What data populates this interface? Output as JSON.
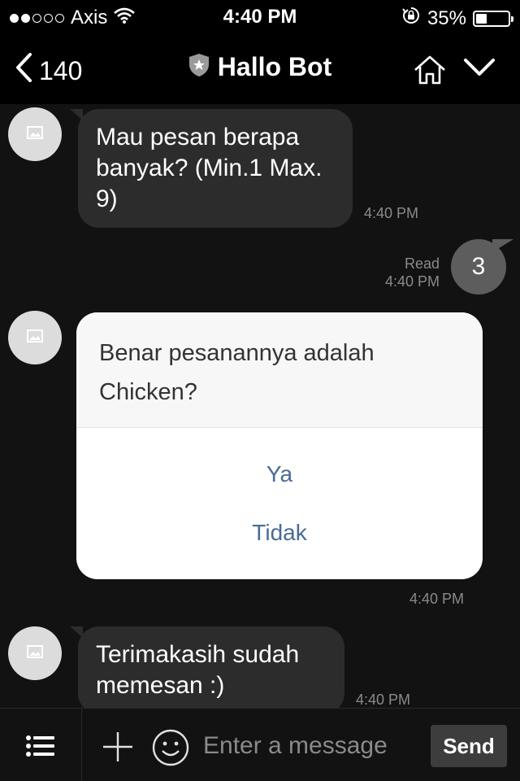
{
  "status_bar": {
    "carrier": "Axis",
    "time": "4:40 PM",
    "battery": "35%",
    "battery_level": 0.35,
    "signal_bars": 2,
    "signal_total": 5
  },
  "header": {
    "back_count": "140",
    "title": "Hallo Bot"
  },
  "messages": [
    {
      "text": "Mau pesan berapa banyak? (Min.1 Max. 9)",
      "time": "4:40 PM"
    },
    {
      "text": "3",
      "status": "Read",
      "time": "4:40 PM"
    },
    {
      "question": "Benar pesanannya adalah Chicken?",
      "options": [
        "Ya",
        "Tidak"
      ],
      "time": "4:40 PM"
    },
    {
      "text": "Terimakasih sudah memesan :)",
      "time": "4:40 PM"
    }
  ],
  "input": {
    "placeholder": "Enter a message",
    "send_label": "Send"
  },
  "colors": {
    "background": "#121212",
    "bubble": "#2c2c2c",
    "my_bubble": "#5d5d5d",
    "option_text": "#4a6b96"
  }
}
